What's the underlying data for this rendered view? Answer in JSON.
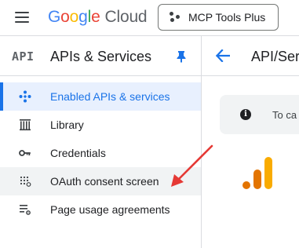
{
  "topbar": {
    "logo_google": [
      "G",
      "o",
      "o",
      "g",
      "l",
      "e"
    ],
    "logo_cloud": "Cloud",
    "project_label": "MCP Tools Plus"
  },
  "sidebar": {
    "badge": "API",
    "title": "APIs & Services",
    "items": [
      {
        "label": "Enabled APIs & services",
        "icon": "diamond-network-icon",
        "active": true
      },
      {
        "label": "Library",
        "icon": "library-icon",
        "active": false
      },
      {
        "label": "Credentials",
        "icon": "key-icon",
        "active": false
      },
      {
        "label": "OAuth consent screen",
        "icon": "oauth-dots-icon",
        "active": false
      },
      {
        "label": "Page usage agreements",
        "icon": "settings-list-icon",
        "active": false
      }
    ]
  },
  "main": {
    "title": "API/Serv",
    "info_text": "To ca"
  },
  "colors": {
    "accent": "#1a73e8",
    "annotation_arrow": "#e53935",
    "analytics_orange": "#f9ab00",
    "analytics_dark_orange": "#e37400"
  }
}
